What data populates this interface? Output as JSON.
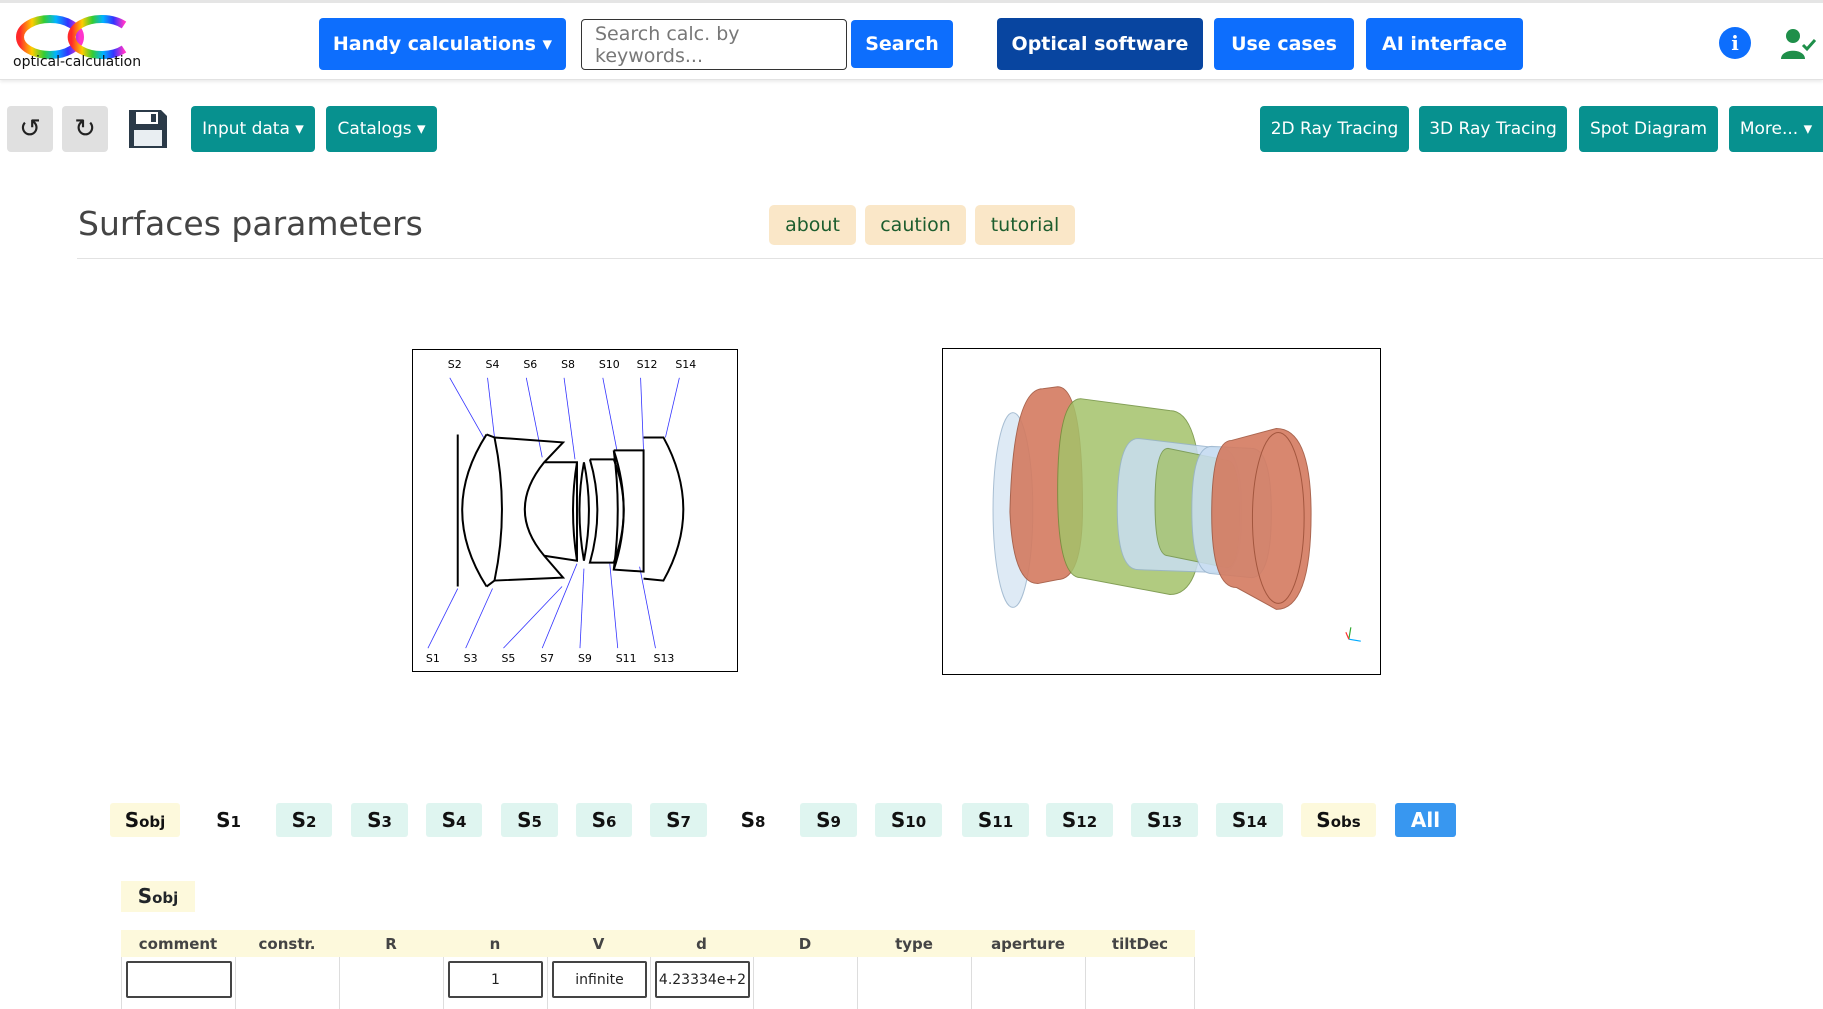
{
  "app": {
    "logo_text": "optical-calculation"
  },
  "nav": {
    "handy": "Handy calculations ▾",
    "search_placeholder": "Search calc. by keywords...",
    "search_btn": "Search",
    "optical_software": "Optical software",
    "use_cases": "Use cases",
    "ai_interface": "AI interface"
  },
  "toolbar": {
    "undo": "↺",
    "redo": "↻",
    "input_data": "Input data ▾",
    "catalogs": "Catalogs ▾",
    "ray2d": "2D Ray Tracing",
    "ray3d": "3D Ray Tracing",
    "spot": "Spot Diagram",
    "more": "More... ▾"
  },
  "page": {
    "title": "Surfaces parameters",
    "pills": [
      "about",
      "caution",
      "tutorial"
    ]
  },
  "diagram2d": {
    "top_labels": [
      "S2",
      "S4",
      "S6",
      "S8",
      "S10",
      "S12",
      "S14"
    ],
    "bottom_labels": [
      "S1",
      "S3",
      "S5",
      "S7",
      "S9",
      "S11",
      "S13"
    ]
  },
  "tabs": [
    {
      "base": "S",
      "sub": "obj"
    },
    {
      "base": "S",
      "sub": "1"
    },
    {
      "base": "S",
      "sub": "2"
    },
    {
      "base": "S",
      "sub": "3"
    },
    {
      "base": "S",
      "sub": "4"
    },
    {
      "base": "S",
      "sub": "5"
    },
    {
      "base": "S",
      "sub": "6"
    },
    {
      "base": "S",
      "sub": "7"
    },
    {
      "base": "S",
      "sub": "8"
    },
    {
      "base": "S",
      "sub": "9"
    },
    {
      "base": "S",
      "sub": "10"
    },
    {
      "base": "S",
      "sub": "11"
    },
    {
      "base": "S",
      "sub": "12"
    },
    {
      "base": "S",
      "sub": "13"
    },
    {
      "base": "S",
      "sub": "14"
    },
    {
      "base": "S",
      "sub": "obs"
    }
  ],
  "tab_all": "All",
  "section": {
    "base": "S",
    "sub": "obj"
  },
  "table": {
    "headers": [
      "comment",
      "constr.",
      "R",
      "n",
      "V",
      "d",
      "D",
      "type",
      "aperture",
      "tiltDec"
    ],
    "row": {
      "comment": "",
      "n": "1",
      "V": "infinite",
      "d": "4.23334e+2"
    }
  }
}
